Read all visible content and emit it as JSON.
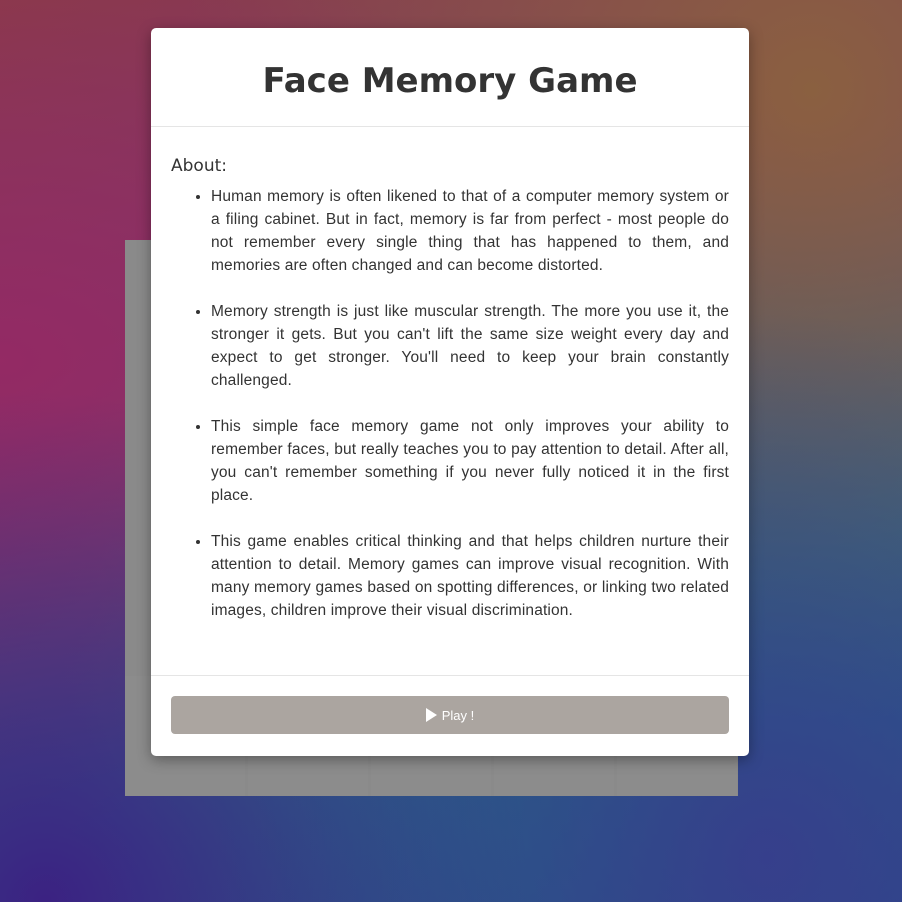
{
  "modal": {
    "title": "Face Memory Game",
    "about_label": "About:",
    "facts": [
      "Human memory is often likened to that of a computer memory system or a filing cabinet. But in fact, memory is far from perfect - most people do not remember every single thing that has happened to them, and memories are often changed and can become distorted.",
      "Memory strength is just like muscular strength. The more you use it, the stronger it gets. But you can't lift the same size weight every day and expect to get stronger. You'll need to keep your brain constantly challenged.",
      "This simple face memory game not only improves your ability to remember faces, but really teaches you to pay attention to detail. After all, you can't remember something if you never fully noticed it in the first place.",
      "This game enables critical thinking and that helps children nurture their attention to detail. Memory games can improve visual recognition. With many memory games based on spotting differences, or linking two related images, children improve their visual discrimination."
    ],
    "play_button": {
      "icon": "play-icon",
      "label": "Play !"
    }
  },
  "board": {
    "tile_count": 5,
    "tile_face_icon": "face-icon",
    "colors": {
      "tile_bg": "#8c8c8c",
      "face_skin": "#7a5040"
    }
  },
  "colors": {
    "button_bg": "#aba5a0",
    "title_text": "#333333"
  }
}
